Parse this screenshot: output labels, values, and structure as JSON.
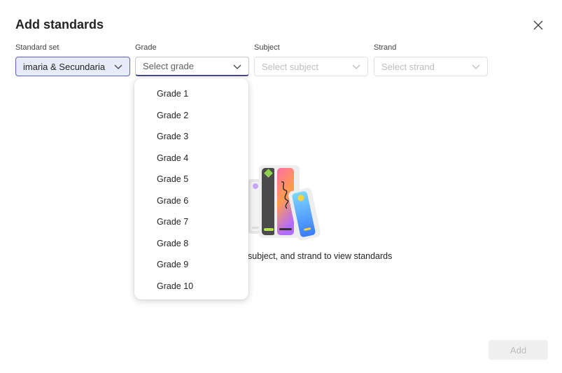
{
  "dialog": {
    "title": "Add standards",
    "close_icon": "close-icon"
  },
  "filters": {
    "standard_set": {
      "label": "Standard set",
      "value": "imaria & Secundaria"
    },
    "grade": {
      "label": "Grade",
      "placeholder": "Select grade"
    },
    "subject": {
      "label": "Subject",
      "placeholder": "Select subject"
    },
    "strand": {
      "label": "Strand",
      "placeholder": "Select strand"
    }
  },
  "grade_options": [
    "Grade 1",
    "Grade 2",
    "Grade 3",
    "Grade 4",
    "Grade 5",
    "Grade 6",
    "Grade 7",
    "Grade 8",
    "Grade 9",
    "Grade 10"
  ],
  "empty_state": {
    "illustration": "books-icon",
    "text": "subject, and strand to view standards"
  },
  "footer": {
    "add_label": "Add"
  },
  "colors": {
    "accent": "#5b5fc7",
    "selected_bg": "#e8ebfa",
    "focus_underline": "#444791"
  }
}
